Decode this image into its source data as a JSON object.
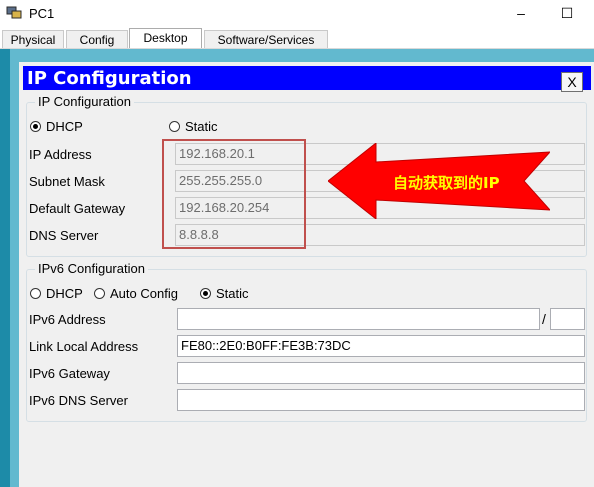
{
  "window": {
    "title": "PC1",
    "minimize": "–",
    "maximize": "☐"
  },
  "tabs": [
    {
      "label": "Physical"
    },
    {
      "label": "Config"
    },
    {
      "label": "Desktop"
    },
    {
      "label": "Software/Services"
    }
  ],
  "ip_window": {
    "title": "IP Configuration",
    "close": "X"
  },
  "ipv4": {
    "legend": "IP Configuration",
    "dhcp_label": "DHCP",
    "static_label": "Static",
    "selected": "DHCP",
    "fields": [
      {
        "label": "IP Address",
        "value": "192.168.20.1"
      },
      {
        "label": "Subnet Mask",
        "value": "255.255.255.0"
      },
      {
        "label": "Default Gateway",
        "value": "192.168.20.254"
      },
      {
        "label": "DNS Server",
        "value": "8.8.8.8"
      }
    ]
  },
  "annotation": {
    "text": "自动获取到的IP",
    "arrow_color": "#ff0000",
    "text_color": "#ffff00"
  },
  "ipv6": {
    "legend": "IPv6 Configuration",
    "dhcp_label": "DHCP",
    "auto_label": "Auto Config",
    "static_label": "Static",
    "selected": "Static",
    "address_label": "IPv6 Address",
    "address_value": "",
    "prefix_separator": "/",
    "prefix_value": "",
    "link_local_label": "Link Local Address",
    "link_local_value": "FE80::2E0:B0FF:FE3B:73DC",
    "gateway_label": "IPv6 Gateway",
    "gateway_value": "",
    "dns_label": "IPv6 DNS Server",
    "dns_value": ""
  },
  "colors": {
    "title_blue": "#0000ff",
    "desktop_teal": "#1d8ba8"
  }
}
